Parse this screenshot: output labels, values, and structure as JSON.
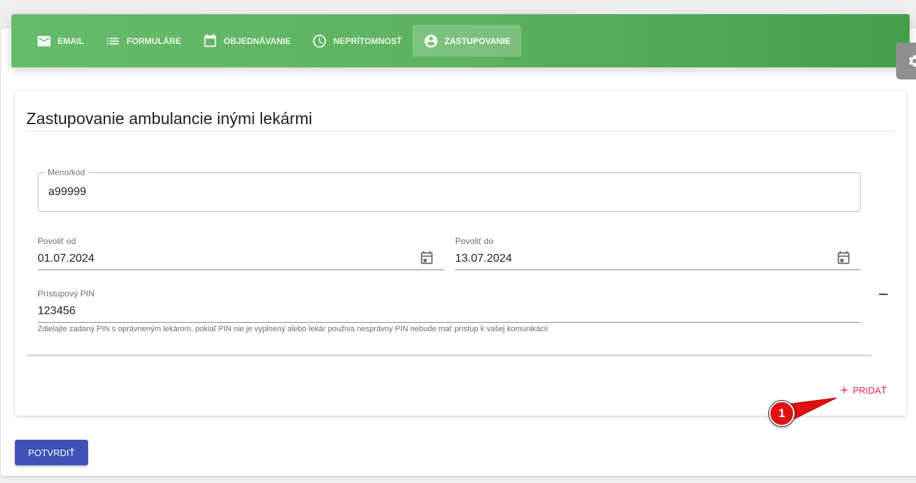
{
  "nav": {
    "tabs": [
      {
        "label": "EMAIL",
        "icon": "mail-icon"
      },
      {
        "label": "FORMULÁRE",
        "icon": "list-icon"
      },
      {
        "label": "OBJEDNÁVANIE",
        "icon": "calendar-icon"
      },
      {
        "label": "NEPRÍTOMNOSŤ",
        "icon": "clock-icon"
      },
      {
        "label": "ZASTUPOVANIE",
        "icon": "account-circle-icon",
        "active": true
      }
    ]
  },
  "page": {
    "title": "Zastupovanie ambulancie inými lekármi"
  },
  "entry": {
    "name_field": {
      "label": "Meno/kód",
      "value": "a99999"
    },
    "from_field": {
      "label": "Povoliť od",
      "value": "01.07.2024"
    },
    "to_field": {
      "label": "Povoliť do",
      "value": "13.07.2024"
    },
    "pin_field": {
      "label": "Prístupový PIN",
      "value": "123456",
      "helper": "Zdielajte zadaný PIN s oprávneným lekárom, pokiaľ PIN nie je vyplnený alebo lekár použiva nesprávny PIN nebude mať prístup k vašej komunikácii"
    }
  },
  "actions": {
    "add_label": "PRIDAŤ",
    "confirm_label": "POTVRDIŤ"
  },
  "annotation": {
    "step_number": "1"
  },
  "colors": {
    "nav_green": "#5cb25f",
    "accent_pink": "#e91e63",
    "primary_indigo": "#3f51b5",
    "callout_red": "#e01010"
  }
}
